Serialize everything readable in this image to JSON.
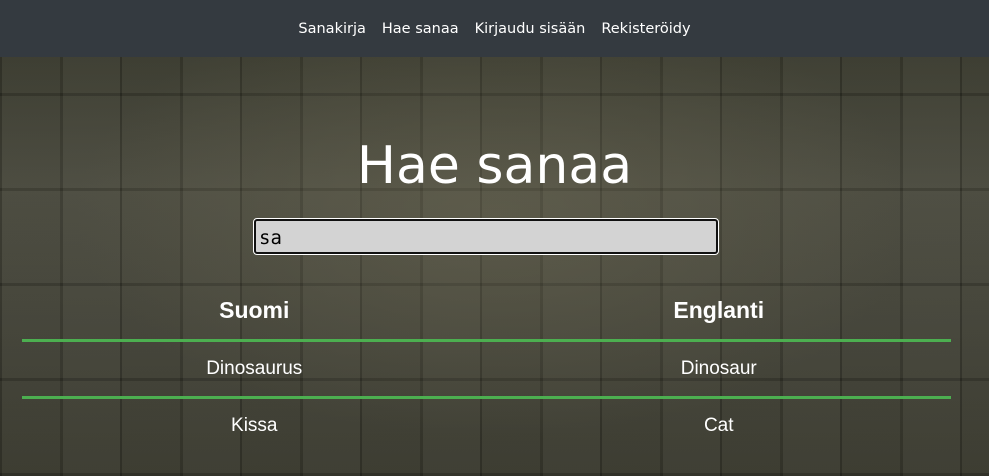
{
  "nav": {
    "items": [
      {
        "label": "Sanakirja"
      },
      {
        "label": "Hae sanaa"
      },
      {
        "label": "Kirjaudu sisään"
      },
      {
        "label": "Rekisteröidy"
      }
    ]
  },
  "main": {
    "title": "Hae sanaa",
    "search": {
      "value": "sa"
    },
    "table": {
      "headers": [
        "Suomi",
        "Englanti"
      ],
      "rows": [
        [
          "Dinosaurus",
          "Dinosaur"
        ],
        [
          "Kissa",
          "Cat"
        ]
      ]
    }
  },
  "colors": {
    "navbar": "#343a40",
    "divider": "#4caf50",
    "input_bg": "#d3d3d3",
    "text": "#ffffff"
  }
}
